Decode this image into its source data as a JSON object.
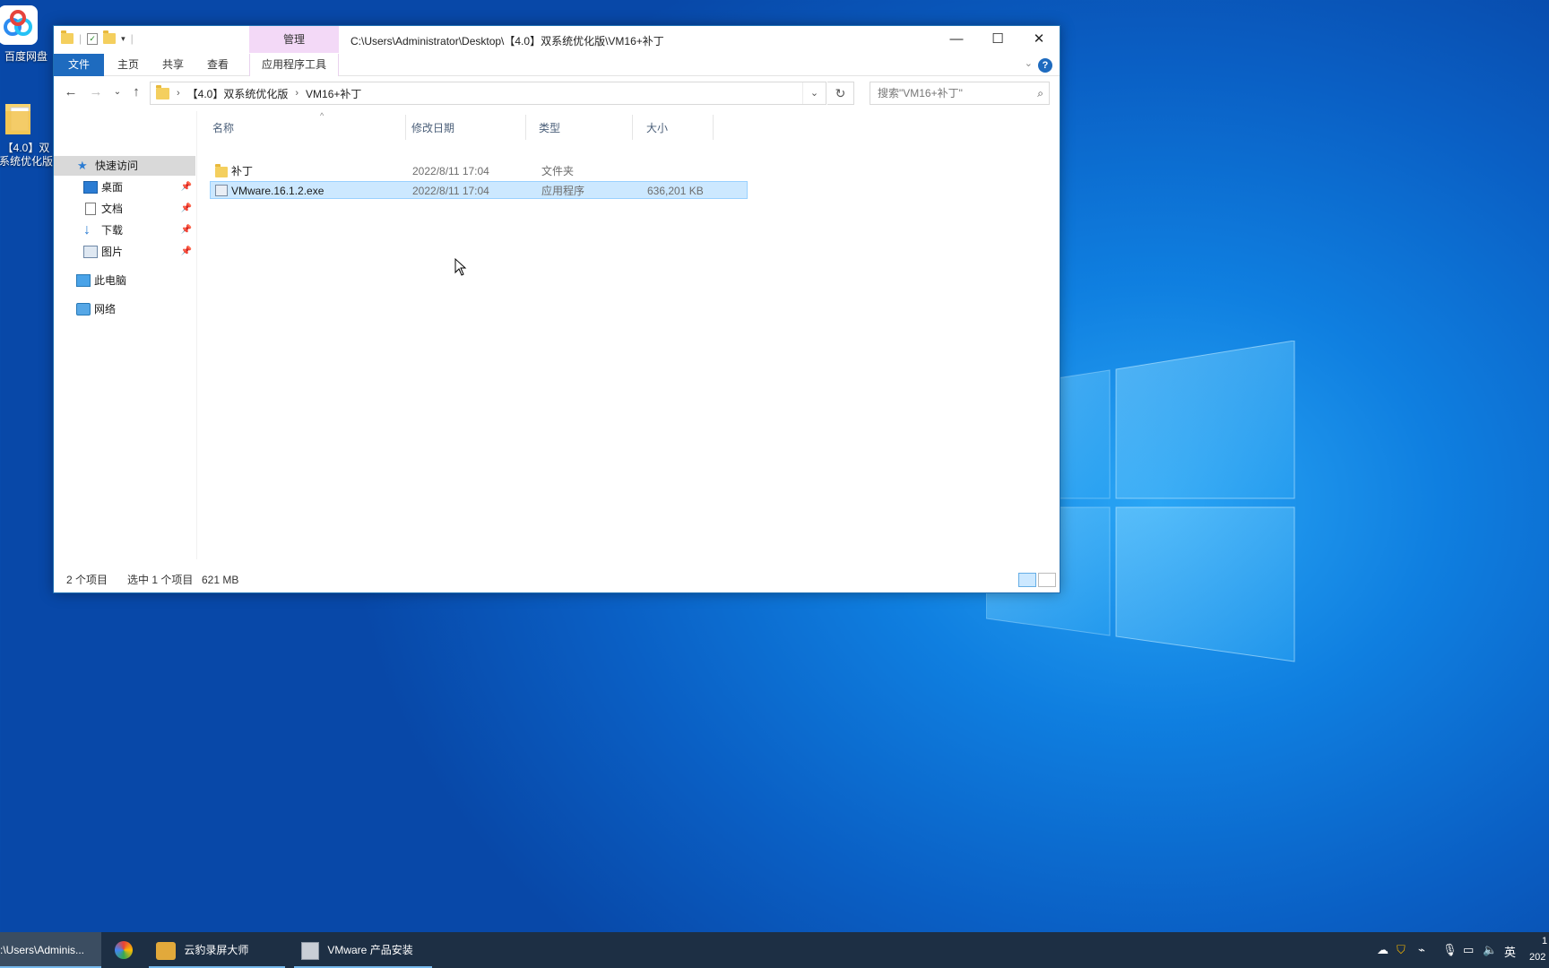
{
  "desktop": {
    "icons": [
      {
        "label": "百度网盘"
      },
      {
        "label": "【4.0】双系统优化版"
      }
    ]
  },
  "window": {
    "title_path": "C:\\Users\\Administrator\\Desktop\\【4.0】双系统优化版\\VM16+补丁",
    "manage_tab": "管理",
    "ribbon_tabs": [
      "文件",
      "主页",
      "共享",
      "查看",
      "应用程序工具"
    ],
    "address": {
      "segments": [
        "【4.0】双系统优化版",
        "VM16+补丁"
      ]
    },
    "search_placeholder": "搜索\"VM16+补丁\"",
    "nav": [
      {
        "label": "快速访问"
      },
      {
        "label": "桌面"
      },
      {
        "label": "文档"
      },
      {
        "label": "下载"
      },
      {
        "label": "图片"
      },
      {
        "label": "此电脑"
      },
      {
        "label": "网络"
      }
    ],
    "columns": [
      "名称",
      "修改日期",
      "类型",
      "大小"
    ],
    "rows": [
      {
        "name": "补丁",
        "date": "2022/8/11 17:04",
        "type": "文件夹",
        "size": ""
      },
      {
        "name": "VMware.16.1.2.exe",
        "date": "2022/8/11 17:04",
        "type": "应用程序",
        "size": "636,201 KB"
      }
    ],
    "status": {
      "count": "2 个项目",
      "selected": "选中 1 个项目",
      "size": "621 MB"
    }
  },
  "taskbar": {
    "items": [
      {
        "label": ":\\Users\\Adminis..."
      },
      {
        "label": ""
      },
      {
        "label": "云豹录屏大师"
      },
      {
        "label": "VMware 产品安装"
      }
    ],
    "tray": {
      "ime": "英",
      "time": "1",
      "date": "202"
    }
  },
  "colors": {
    "accent": "#1e6bbf",
    "selection": "#cce8ff",
    "taskbar": "#1d2f44",
    "manage_tab": "#f3d9f7"
  }
}
